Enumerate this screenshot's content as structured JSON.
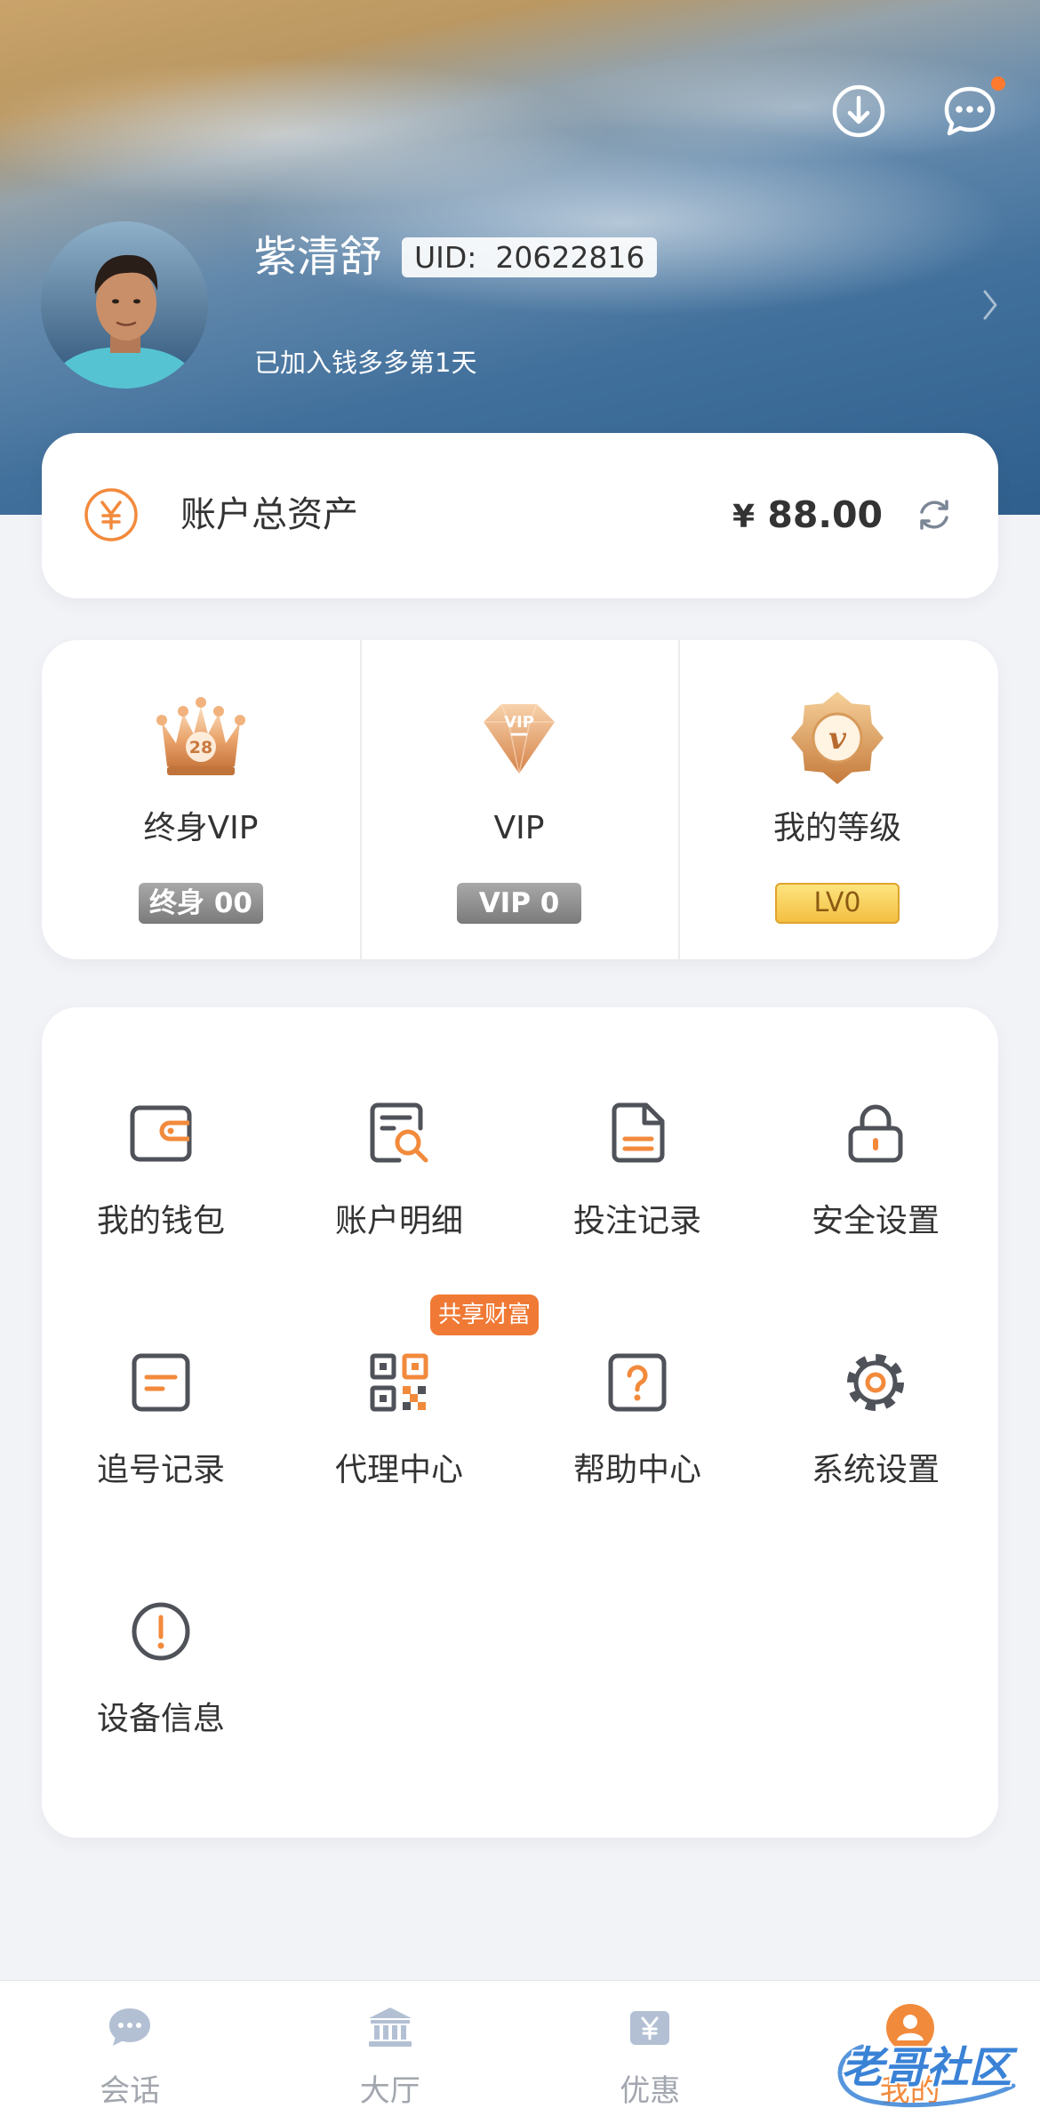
{
  "header": {
    "download_icon": "download-icon",
    "message_icon": "message-icon",
    "unread_dot": true,
    "user": {
      "name": "紫清舒",
      "uid_label": "UID:",
      "uid": "20622816",
      "joined_text": "已加入钱多多第1天"
    }
  },
  "assets": {
    "icon": "yen-icon",
    "label": "账户总资产",
    "currency": "¥",
    "amount": "88.00",
    "refresh_icon": "refresh-icon"
  },
  "vip": [
    {
      "icon": "crown-icon",
      "icon_text": "28",
      "label": "终身VIP",
      "badge": "终身 00"
    },
    {
      "icon": "vip-gem-icon",
      "icon_text": "VIP",
      "label": "VIP",
      "badge": "VIP 0"
    },
    {
      "icon": "level-star-icon",
      "icon_text": "v",
      "label": "我的等级",
      "badge": "LV0"
    }
  ],
  "menu": [
    {
      "icon": "wallet-icon",
      "label": "我的钱包"
    },
    {
      "icon": "account-detail-icon",
      "label": "账户明细"
    },
    {
      "icon": "bet-record-icon",
      "label": "投注记录"
    },
    {
      "icon": "lock-icon",
      "label": "安全设置"
    },
    {
      "icon": "chase-record-icon",
      "label": "追号记录"
    },
    {
      "icon": "qr-code-icon",
      "label": "代理中心",
      "badge": "共享财富"
    },
    {
      "icon": "help-icon",
      "label": "帮助中心"
    },
    {
      "icon": "gear-icon",
      "label": "系统设置"
    },
    {
      "icon": "info-icon",
      "label": "设备信息"
    }
  ],
  "nav": {
    "active_index": 3,
    "items": [
      {
        "icon": "chat-icon",
        "label": "会话"
      },
      {
        "icon": "hall-icon",
        "label": "大厅"
      },
      {
        "icon": "promo-icon",
        "label": "优惠"
      },
      {
        "icon": "profile-icon",
        "label": "我的"
      }
    ]
  },
  "watermark": "老哥社区",
  "colors": {
    "accent": "#f28a3c",
    "text": "#333333",
    "icon_gray": "#4f5259",
    "nav_inactive": "#a2a6ae",
    "page_background": "#f2f3f7",
    "level_badge": "#f6c84c",
    "tag_background": "#f07a35"
  }
}
